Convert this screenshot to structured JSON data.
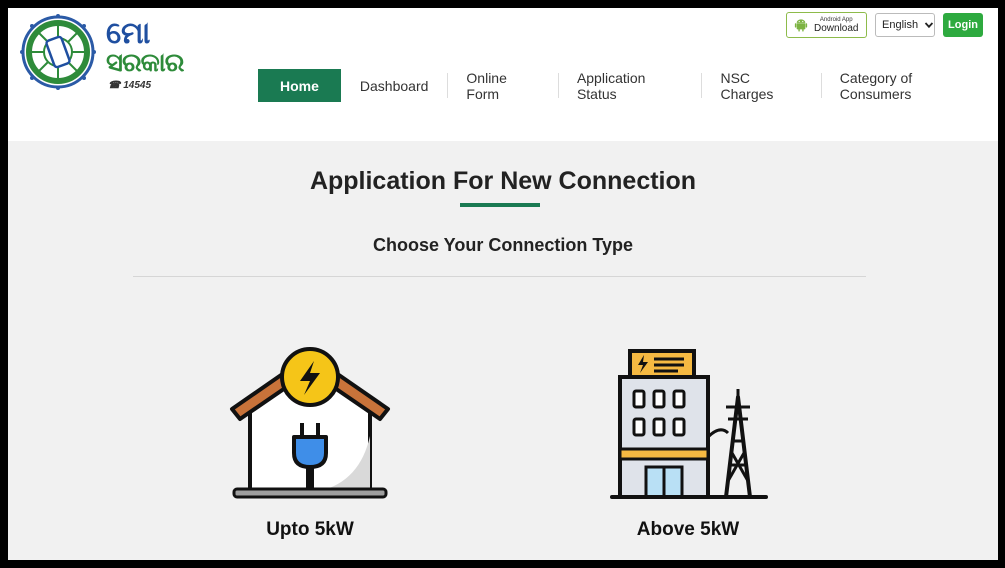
{
  "header": {
    "logo": {
      "line1": "ମୋ",
      "line2": "ସରକାର",
      "phone": "☎ 14545",
      "icon": "mo-sarkar-wheel-logo"
    },
    "app_download": {
      "small": "Android App",
      "big": "Download",
      "icon": "android-icon"
    },
    "language": {
      "selected": "English"
    },
    "login_label": "Login",
    "nav": [
      {
        "label": "Home",
        "active": true
      },
      {
        "label": "Dashboard"
      },
      {
        "label": "Online Form"
      },
      {
        "label": "Application Status"
      },
      {
        "label": "NSC Charges"
      },
      {
        "label": "Category of Consumers"
      }
    ]
  },
  "main": {
    "title": "Application For New Connection",
    "subtitle": "Choose Your Connection Type",
    "options": [
      {
        "label": "Upto 5kW",
        "icon": "house-plug-icon"
      },
      {
        "label": "Above 5kW",
        "icon": "building-tower-icon"
      }
    ]
  },
  "colors": {
    "accent_green": "#1a7a52",
    "login_green": "#2eaa3f",
    "background": "#f1f1f1",
    "logo_blue": "#1f4fa0",
    "logo_green": "#2e8b3a"
  }
}
